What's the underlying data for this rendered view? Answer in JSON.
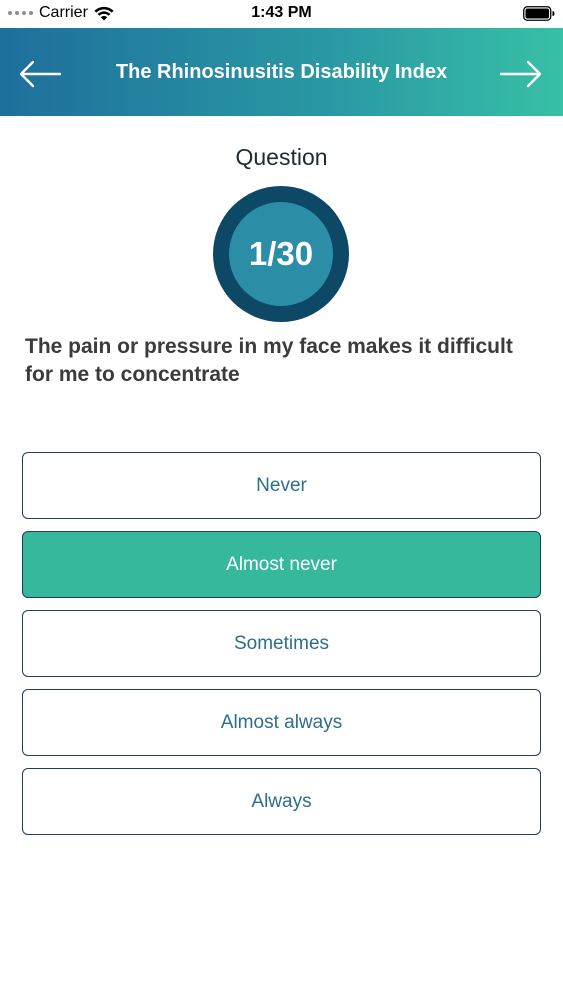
{
  "status_bar": {
    "carrier": "Carrier",
    "time": "1:43 PM"
  },
  "header": {
    "title": "The Rhinosinusitis Disability Index",
    "back_icon": "arrow-left-icon",
    "forward_icon": "arrow-right-icon"
  },
  "question": {
    "label": "Question",
    "progress": "1/30",
    "text": "The pain or pressure in my face makes it difficult for me to concentrate"
  },
  "options": [
    {
      "label": "Never",
      "selected": false
    },
    {
      "label": "Almost never",
      "selected": true
    },
    {
      "label": "Sometimes",
      "selected": false
    },
    {
      "label": "Almost always",
      "selected": false
    },
    {
      "label": "Always",
      "selected": false
    }
  ],
  "colors": {
    "header_gradient_start": "#1e6f9c",
    "header_gradient_end": "#37c0a6",
    "selected_option": "#36b89c",
    "ring_outer": "#0d4866",
    "ring_inner": "#2b8ea6"
  }
}
